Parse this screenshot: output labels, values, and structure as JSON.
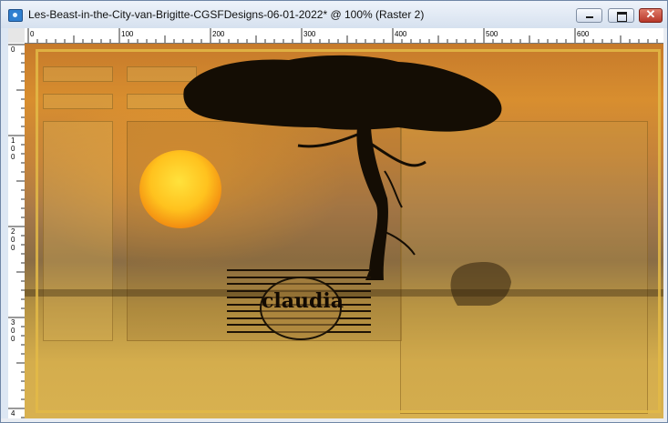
{
  "window": {
    "title": "Les-Beast-in-the-City-van-Brigitte-CGSFDesigns-06-01-2022* @ 100% (Raster 2)",
    "close_glyph": "✕"
  },
  "ruler": {
    "horizontal_labels": [
      "0",
      "100",
      "200",
      "300",
      "400",
      "500",
      "600"
    ],
    "vertical_labels": [
      "0",
      "1\n0\n0",
      "2\n0\n0",
      "3\n0\n0",
      "4"
    ]
  },
  "canvas": {
    "watermark_text": "claudia",
    "stripe_count": 10
  },
  "colors": {
    "sky_orange": "#c67a2b",
    "sun_yellow": "#ffe23c",
    "gold": "#d8b150",
    "silhouette": "#140d04"
  },
  "icons": {
    "app": "image-document-icon",
    "minimize": "minimize-icon",
    "maximize": "maximize-icon",
    "close": "close-icon"
  }
}
